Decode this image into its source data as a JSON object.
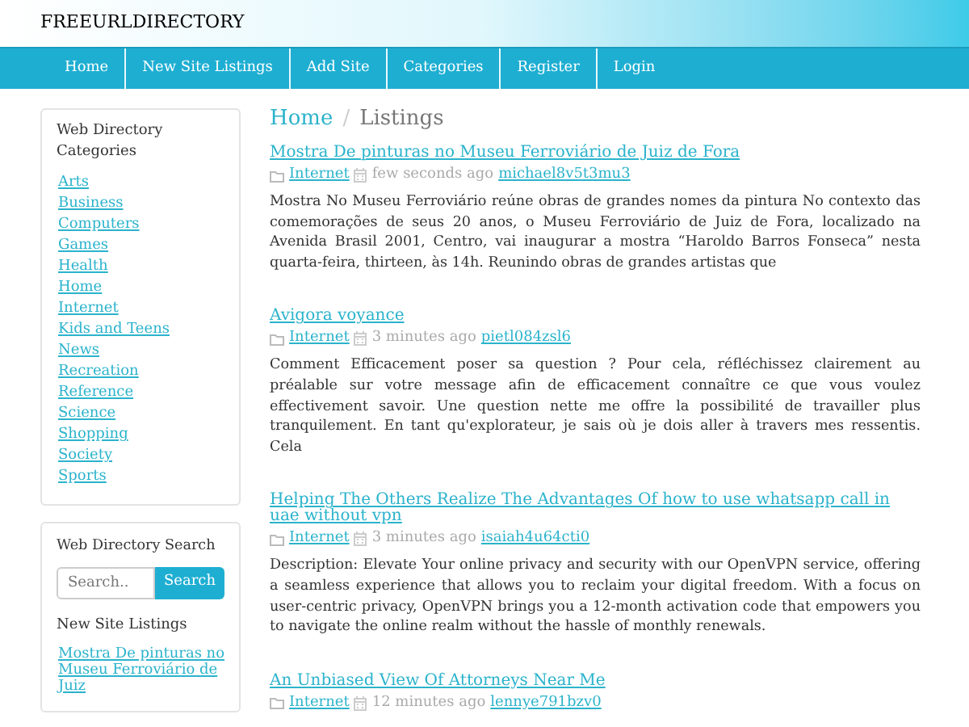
{
  "site_title": "FREEURLDIRECTORY",
  "nav": [
    "Home",
    "New Site Listings",
    "Add Site",
    "Categories",
    "Register",
    "Login"
  ],
  "sidebar": {
    "categories_title": "Web Directory Categories",
    "categories": [
      "Arts",
      "Business",
      "Computers",
      "Games",
      "Health",
      "Home",
      "Internet",
      "Kids and Teens",
      "News",
      "Recreation",
      "Reference",
      "Science",
      "Shopping",
      "Society",
      "Sports"
    ],
    "search_title": "Web Directory Search",
    "search": {
      "placeholder": "Search..",
      "button": "Search"
    },
    "new_listings_title": "New Site Listings",
    "new_listings": [
      "Mostra De pinturas no Museu Ferroviário de Juiz"
    ]
  },
  "breadcrumb": [
    "Home",
    "Listings"
  ],
  "breadcrumb_separator": "/",
  "listings": [
    {
      "title": "Mostra De pinturas no Museu Ferroviário de Juiz de Fora",
      "category": "Internet",
      "time": "few seconds ago",
      "user": "michael8v5t3mu3",
      "body": "Mostra No Museu Ferroviário reúne obras de grandes nomes da pintura No contexto das comemorações de seus 20 anos, o Museu Ferroviário de Juiz de Fora, localizado na Avenida Brasil 2001, Centro, vai inaugurar a mostra “Haroldo Barros Fonseca” nesta quarta-feira, thirteen, às 14h. Reunindo obras de grandes artistas que"
    },
    {
      "title": "Avigora voyance",
      "category": "Internet",
      "time": "3 minutes ago",
      "user": "pietl084zsl6",
      "body": "Comment Efficacement poser sa question ? Pour cela, réfléchissez clairement au préalable sur votre message afin de efficacement connaître ce que vous voulez effectivement savoir. Une question nette me offre la possibilité de travailler plus tranquilement. En tant qu'explorateur, je sais où je dois aller à travers mes ressentis. Cela"
    },
    {
      "title": "Helping The Others Realize The Advantages Of how to use whatsapp call in uae without vpn",
      "category": "Internet",
      "time": "3 minutes ago",
      "user": "isaiah4u64cti0",
      "body": "Description: Elevate Your online privacy and security with our OpenVPN service, offering a seamless experience that allows you to reclaim your digital freedom. With a focus on user-centric privacy, OpenVPN brings you a 12-month activation code that empowers you to navigate the online realm without the hassle of monthly renewals."
    },
    {
      "title": "An Unbiased View Of Attorneys Near Me",
      "category": "Internet",
      "time": "12 minutes ago",
      "user": "lennye791bzv0"
    }
  ]
}
